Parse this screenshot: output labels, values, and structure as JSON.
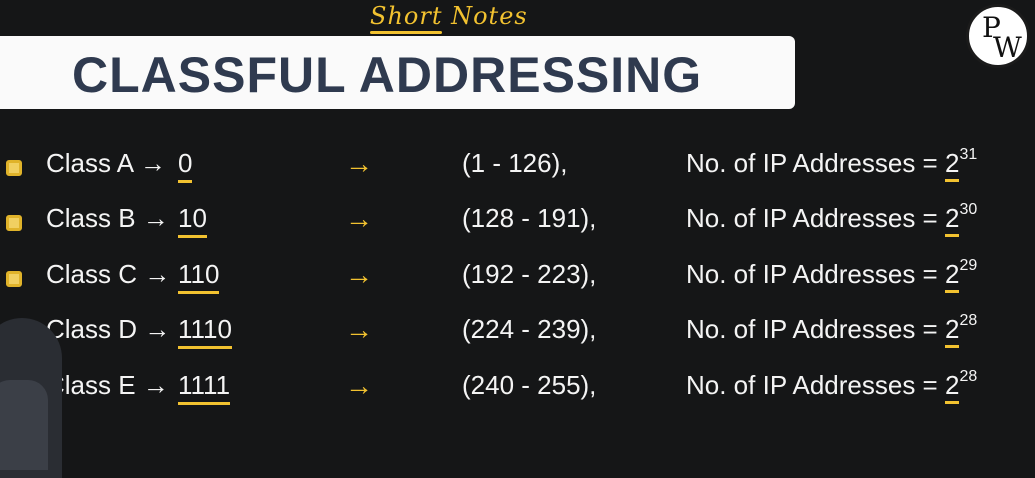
{
  "header": {
    "handwritten_note": "Short Notes",
    "title": "CLASSFUL ADDRESSING",
    "logo": {
      "p": "P",
      "w": "W"
    }
  },
  "rows": [
    {
      "class_label": "Class A →",
      "bits": "0",
      "arrow": "→",
      "range": "(1 - 126),",
      "count_label": "No. of IP Addresses =",
      "base": "2",
      "exp": "31"
    },
    {
      "class_label": "Class B →",
      "bits": "10",
      "arrow": "→",
      "range": "(128 - 191),",
      "count_label": "No. of IP Addresses =",
      "base": "2",
      "exp": "30"
    },
    {
      "class_label": "Class C →",
      "bits": "110",
      "arrow": "→",
      "range": "(192 - 223),",
      "count_label": "No. of IP Addresses =",
      "base": "2",
      "exp": "29"
    },
    {
      "class_label": "Class D →",
      "bits": "1110",
      "arrow": "→",
      "range": "(224 - 239),",
      "count_label": "No. of IP Addresses =",
      "base": "2",
      "exp": "28"
    },
    {
      "class_label": "Class E →",
      "bits": "1111",
      "arrow": "→",
      "range": "(240 - 255),",
      "count_label": "No. of IP Addresses =",
      "base": "2",
      "exp": "28"
    }
  ],
  "colors": {
    "accent": "#f2c230",
    "banner_text": "#2f3a4f",
    "background": "#151617"
  }
}
